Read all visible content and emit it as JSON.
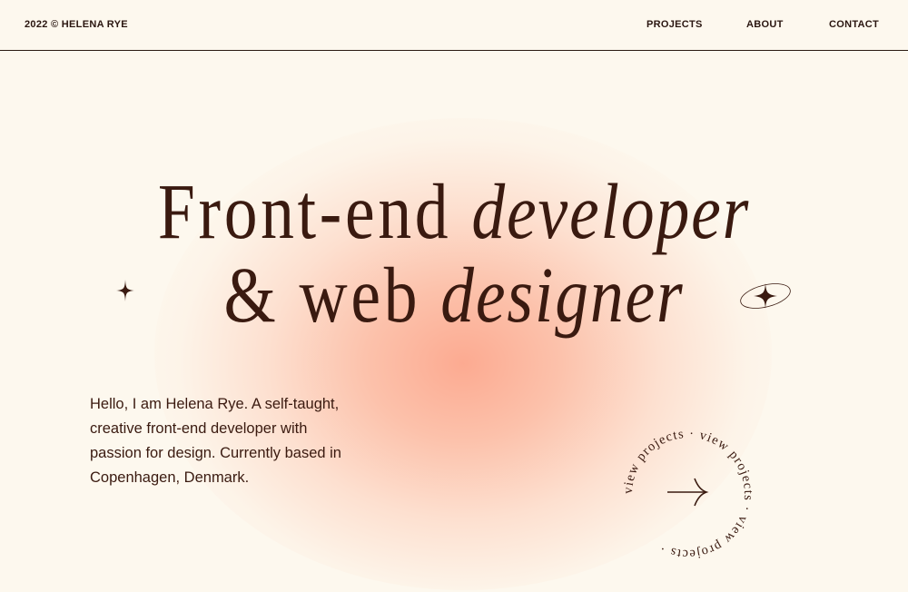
{
  "header": {
    "copyright": "2022 © HELENA RYE",
    "nav": {
      "projects": "PROJECTS",
      "about": "ABOUT",
      "contact": "CONTACT"
    }
  },
  "hero": {
    "line1_a": "Front-end ",
    "line1_b": "developer",
    "line2_a": "& web ",
    "line2_b": "designer"
  },
  "intro": {
    "text": "Hello, I am Helena Rye. A self-taught, creative front-end developer with passion for design. Currently based in Copenhagen, Denmark."
  },
  "cta": {
    "circular_text": "view projects · view projects · view projects · ",
    "icon": "arrow-right-icon"
  },
  "colors": {
    "background": "#fdf8ee",
    "text": "#3a1a10",
    "blob": "#fca68c"
  },
  "icons": {
    "sparkle_left": "sparkle-icon",
    "sparkle_right": "sparkle-orbit-icon"
  }
}
